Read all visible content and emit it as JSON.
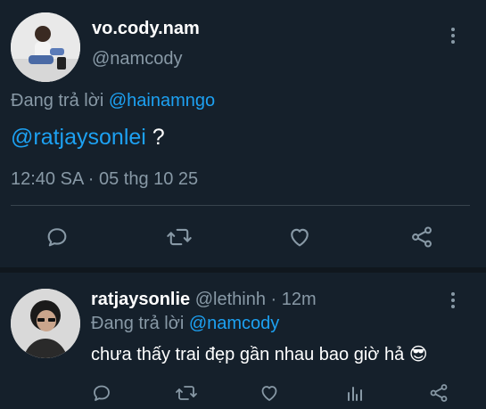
{
  "main_tweet": {
    "display_name": "vo.cody.nam",
    "handle": "@namcody",
    "reply_prefix": "Đang trả lời",
    "reply_to": "@hainamngo",
    "body_mention": "@ratjaysonlei",
    "body_rest": " ?",
    "timestamp": "12:40 SA · 05 thg 10 25",
    "more_icon": "more-vertical-icon",
    "actions": [
      "reply-icon",
      "retweet-icon",
      "like-icon",
      "share-icon"
    ]
  },
  "reply_tweet": {
    "display_name": "ratjaysonlie",
    "handle_time": "@lethinh · 12m",
    "reply_prefix": "Đang trả lời",
    "reply_to": "@namcody",
    "body": "chưa thấy trai đẹp gần nhau bao giờ hả",
    "emoji": "😎",
    "actions": [
      "reply-icon",
      "retweet-icon",
      "like-icon",
      "analytics-icon",
      "share-icon"
    ]
  },
  "colors": {
    "background": "#15202b",
    "accent": "#1da1f2",
    "muted": "#8899a6",
    "divider": "#38444d"
  }
}
